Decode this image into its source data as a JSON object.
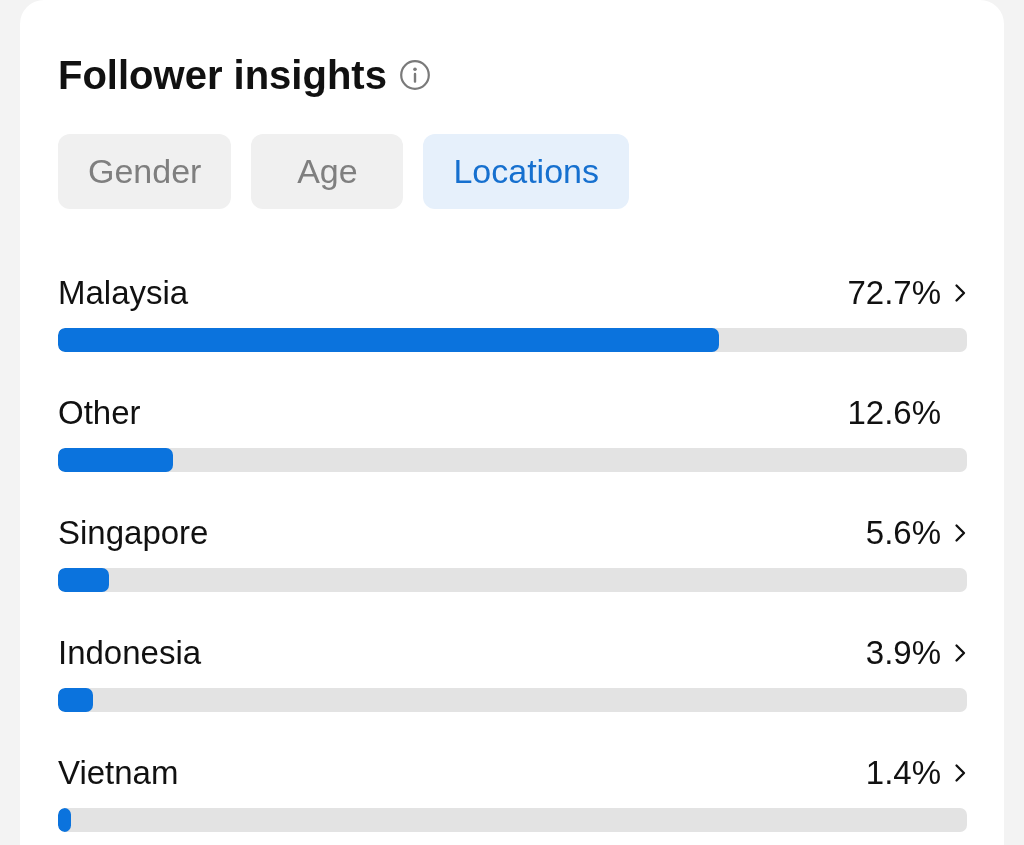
{
  "card": {
    "title": "Follower insights",
    "tabs": [
      {
        "label": "Gender",
        "selected": false
      },
      {
        "label": "Age",
        "selected": false
      },
      {
        "label": "Locations",
        "selected": true
      }
    ],
    "locations": [
      {
        "name": "Malaysia",
        "percent": "72.7%",
        "level": 0.727,
        "chevron": true
      },
      {
        "name": "Other",
        "percent": "12.6%",
        "level": 0.126,
        "chevron": false
      },
      {
        "name": "Singapore",
        "percent": "5.6%",
        "level": 0.056,
        "chevron": true
      },
      {
        "name": "Indonesia",
        "percent": "3.9%",
        "level": 0.039,
        "chevron": true
      },
      {
        "name": "Vietnam",
        "percent": "1.4%",
        "level": 0.014,
        "chevron": true
      }
    ]
  }
}
